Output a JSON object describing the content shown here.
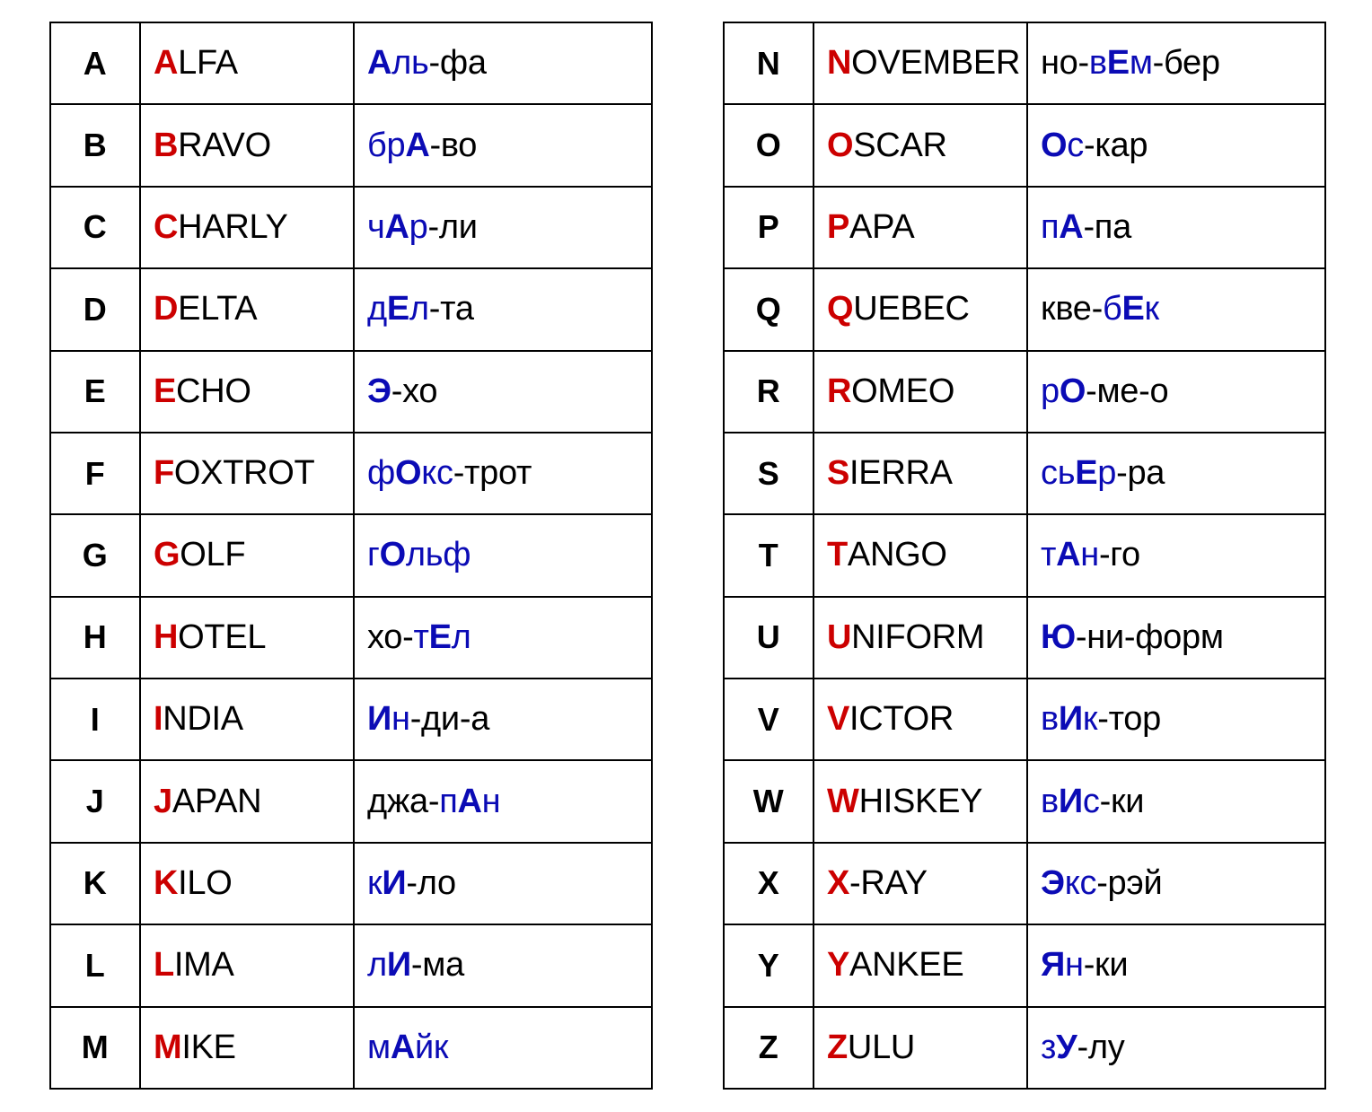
{
  "document": {
    "title": "NATO Phonetic Alphabet with Russian Pronunciation",
    "colors": {
      "initial_letter_red": "#CC0000",
      "stress_blue": "#0b0bb5",
      "text_black": "#000000",
      "border_black": "#000000",
      "background": "#FFFFFF"
    }
  },
  "tables": [
    {
      "name": "left-table",
      "rows": [
        {
          "letter": "A",
          "word_initial": "A",
          "word_rest": "LFA",
          "word_full": "ALFA",
          "pron_full": "Аль-фа",
          "pron_parts": [
            {
              "text": "А",
              "style": "stress-vowel"
            },
            {
              "text": "ль",
              "style": "stress-syllable"
            },
            {
              "text": "-фа",
              "style": "plain"
            }
          ]
        },
        {
          "letter": "B",
          "word_initial": "B",
          "word_rest": "RAVO",
          "word_full": "BRAVO",
          "pron_full": "брА-во",
          "pron_parts": [
            {
              "text": "бр",
              "style": "stress-syllable"
            },
            {
              "text": "А",
              "style": "stress-vowel"
            },
            {
              "text": "-во",
              "style": "plain"
            }
          ]
        },
        {
          "letter": "C",
          "word_initial": "C",
          "word_rest": "HARLY",
          "word_full": "CHARLY",
          "pron_full": "чАр-ли",
          "pron_parts": [
            {
              "text": "ч",
              "style": "stress-syllable"
            },
            {
              "text": "А",
              "style": "stress-vowel"
            },
            {
              "text": "р",
              "style": "stress-syllable"
            },
            {
              "text": "-ли",
              "style": "plain"
            }
          ]
        },
        {
          "letter": "D",
          "word_initial": "D",
          "word_rest": "ELTA",
          "word_full": "DELTA",
          "pron_full": "дЕл-та",
          "pron_parts": [
            {
              "text": "д",
              "style": "stress-syllable"
            },
            {
              "text": "Е",
              "style": "stress-vowel"
            },
            {
              "text": "л",
              "style": "stress-syllable"
            },
            {
              "text": "-та",
              "style": "plain"
            }
          ]
        },
        {
          "letter": "E",
          "word_initial": "E",
          "word_rest": "CHO",
          "word_full": "ECHO",
          "pron_full": "Э-хо",
          "pron_parts": [
            {
              "text": "Э",
              "style": "stress-vowel"
            },
            {
              "text": "-хо",
              "style": "plain"
            }
          ]
        },
        {
          "letter": "F",
          "word_initial": "F",
          "word_rest": "OXTROT",
          "word_full": "FOXTROT",
          "pron_full": "фОкс-трот",
          "pron_parts": [
            {
              "text": "ф",
              "style": "stress-syllable"
            },
            {
              "text": "О",
              "style": "stress-vowel"
            },
            {
              "text": "кс",
              "style": "stress-syllable"
            },
            {
              "text": "-трот",
              "style": "plain"
            }
          ]
        },
        {
          "letter": "G",
          "word_initial": "G",
          "word_rest": "OLF",
          "word_full": "GOLF",
          "pron_full": "гОльф",
          "pron_parts": [
            {
              "text": "г",
              "style": "stress-syllable"
            },
            {
              "text": "О",
              "style": "stress-vowel"
            },
            {
              "text": "льф",
              "style": "stress-syllable"
            }
          ]
        },
        {
          "letter": "H",
          "word_initial": "H",
          "word_rest": "OTEL",
          "word_full": "HOTEL",
          "pron_full": "хо-тЕл",
          "pron_parts": [
            {
              "text": "хо-",
              "style": "plain"
            },
            {
              "text": "т",
              "style": "stress-syllable"
            },
            {
              "text": "Е",
              "style": "stress-vowel"
            },
            {
              "text": "л",
              "style": "stress-syllable"
            }
          ]
        },
        {
          "letter": "I",
          "word_initial": "I",
          "word_rest": "NDIA",
          "word_full": "INDIA",
          "pron_full": "Ин-ди-а",
          "pron_parts": [
            {
              "text": "И",
              "style": "stress-vowel"
            },
            {
              "text": "н",
              "style": "stress-syllable"
            },
            {
              "text": "-ди-а",
              "style": "plain"
            }
          ]
        },
        {
          "letter": "J",
          "word_initial": "J",
          "word_rest": "APAN",
          "word_full": "JAPAN",
          "pron_full": "джа-пАн",
          "pron_parts": [
            {
              "text": "джа-",
              "style": "plain"
            },
            {
              "text": "п",
              "style": "stress-syllable"
            },
            {
              "text": "А",
              "style": "stress-vowel"
            },
            {
              "text": "н",
              "style": "stress-syllable"
            }
          ]
        },
        {
          "letter": "K",
          "word_initial": "K",
          "word_rest": "ILO",
          "word_full": "KILO",
          "pron_full": "кИ-ло",
          "pron_parts": [
            {
              "text": "к",
              "style": "stress-syllable"
            },
            {
              "text": "И",
              "style": "stress-vowel"
            },
            {
              "text": "-ло",
              "style": "plain"
            }
          ]
        },
        {
          "letter": "L",
          "word_initial": "L",
          "word_rest": "IMA",
          "word_full": "LIMA",
          "pron_full": "лИ-ма",
          "pron_parts": [
            {
              "text": "л",
              "style": "stress-syllable"
            },
            {
              "text": "И",
              "style": "stress-vowel"
            },
            {
              "text": "-ма",
              "style": "plain"
            }
          ]
        },
        {
          "letter": "M",
          "word_initial": "M",
          "word_rest": "IKE",
          "word_full": "MIKE",
          "pron_full": "мАйк",
          "pron_parts": [
            {
              "text": "м",
              "style": "stress-syllable"
            },
            {
              "text": "А",
              "style": "stress-vowel"
            },
            {
              "text": "йк",
              "style": "stress-syllable"
            }
          ]
        }
      ]
    },
    {
      "name": "right-table",
      "rows": [
        {
          "letter": "N",
          "word_initial": "N",
          "word_rest": "OVEMBER",
          "word_full": "NOVEMBER",
          "pron_full": "но-вЕм-бер",
          "pron_parts": [
            {
              "text": "но-",
              "style": "plain"
            },
            {
              "text": "в",
              "style": "stress-syllable"
            },
            {
              "text": "Е",
              "style": "stress-vowel"
            },
            {
              "text": "м",
              "style": "stress-syllable"
            },
            {
              "text": "-бер",
              "style": "plain"
            }
          ]
        },
        {
          "letter": "O",
          "word_initial": "O",
          "word_rest": "SCAR",
          "word_full": "OSCAR",
          "pron_full": "Ос-кар",
          "pron_parts": [
            {
              "text": "О",
              "style": "stress-vowel"
            },
            {
              "text": "с",
              "style": "stress-syllable"
            },
            {
              "text": "-кар",
              "style": "plain"
            }
          ]
        },
        {
          "letter": "P",
          "word_initial": "P",
          "word_rest": "APA",
          "word_full": "PAPA",
          "pron_full": "пА-па",
          "pron_parts": [
            {
              "text": "п",
              "style": "stress-syllable"
            },
            {
              "text": "А",
              "style": "stress-vowel"
            },
            {
              "text": "-па",
              "style": "plain"
            }
          ]
        },
        {
          "letter": "Q",
          "word_initial": "Q",
          "word_rest": "UEBEC",
          "word_full": "QUEBEC",
          "pron_full": "кве-бЕк",
          "pron_parts": [
            {
              "text": "кве-",
              "style": "plain"
            },
            {
              "text": "б",
              "style": "stress-syllable"
            },
            {
              "text": "Е",
              "style": "stress-vowel"
            },
            {
              "text": "к",
              "style": "stress-syllable"
            }
          ]
        },
        {
          "letter": "R",
          "word_initial": "R",
          "word_rest": "OMEO",
          "word_full": "ROMEO",
          "pron_full": "рО-ме-о",
          "pron_parts": [
            {
              "text": "р",
              "style": "stress-syllable"
            },
            {
              "text": "О",
              "style": "stress-vowel"
            },
            {
              "text": "-ме-о",
              "style": "plain"
            }
          ]
        },
        {
          "letter": "S",
          "word_initial": "S",
          "word_rest": "IERRA",
          "word_full": "SIERRA",
          "pron_full": "сьЕр-ра",
          "pron_parts": [
            {
              "text": "сь",
              "style": "stress-syllable"
            },
            {
              "text": "Е",
              "style": "stress-vowel"
            },
            {
              "text": "р",
              "style": "stress-syllable"
            },
            {
              "text": "-ра",
              "style": "plain"
            }
          ]
        },
        {
          "letter": "T",
          "word_initial": "T",
          "word_rest": "ANGO",
          "word_full": "TANGO",
          "pron_full": "тАн-го",
          "pron_parts": [
            {
              "text": "т",
              "style": "stress-syllable"
            },
            {
              "text": "А",
              "style": "stress-vowel"
            },
            {
              "text": "н",
              "style": "stress-syllable"
            },
            {
              "text": "-го",
              "style": "plain"
            }
          ]
        },
        {
          "letter": "U",
          "word_initial": "U",
          "word_rest": "NIFORM",
          "word_full": "UNIFORM",
          "pron_full": "Ю-ни-форм",
          "pron_parts": [
            {
              "text": "Ю",
              "style": "stress-vowel"
            },
            {
              "text": "-ни-форм",
              "style": "plain"
            }
          ]
        },
        {
          "letter": "V",
          "word_initial": "V",
          "word_rest": "ICTOR",
          "word_full": "VICTOR",
          "pron_full": "вИк-тор",
          "pron_parts": [
            {
              "text": "в",
              "style": "stress-syllable"
            },
            {
              "text": "И",
              "style": "stress-vowel"
            },
            {
              "text": "к",
              "style": "stress-syllable"
            },
            {
              "text": "-тор",
              "style": "plain"
            }
          ]
        },
        {
          "letter": "W",
          "word_initial": "W",
          "word_rest": "HISKEY",
          "word_full": "WHISKEY",
          "pron_full": "вИс-ки",
          "pron_parts": [
            {
              "text": "в",
              "style": "stress-syllable"
            },
            {
              "text": "И",
              "style": "stress-vowel"
            },
            {
              "text": "с",
              "style": "stress-syllable"
            },
            {
              "text": "-ки",
              "style": "plain"
            }
          ]
        },
        {
          "letter": "X",
          "word_initial": "X",
          "word_rest": "-RAY",
          "word_full": "X-RAY",
          "pron_full": "Экс-рэй",
          "pron_parts": [
            {
              "text": "Э",
              "style": "stress-vowel"
            },
            {
              "text": "кс",
              "style": "stress-syllable"
            },
            {
              "text": "-рэй",
              "style": "plain"
            }
          ]
        },
        {
          "letter": "Y",
          "word_initial": "Y",
          "word_rest": "ANKEE",
          "word_full": "YANKEE",
          "pron_full": "Ян-ки",
          "pron_parts": [
            {
              "text": "Я",
              "style": "stress-vowel"
            },
            {
              "text": "н",
              "style": "stress-syllable"
            },
            {
              "text": "-ки",
              "style": "plain"
            }
          ]
        },
        {
          "letter": "Z",
          "word_initial": "Z",
          "word_rest": "ULU",
          "word_full": "ZULU",
          "pron_full": "зУ-лу",
          "pron_parts": [
            {
              "text": "з",
              "style": "stress-syllable"
            },
            {
              "text": "У",
              "style": "stress-vowel"
            },
            {
              "text": "-лу",
              "style": "plain"
            }
          ]
        }
      ]
    }
  ]
}
